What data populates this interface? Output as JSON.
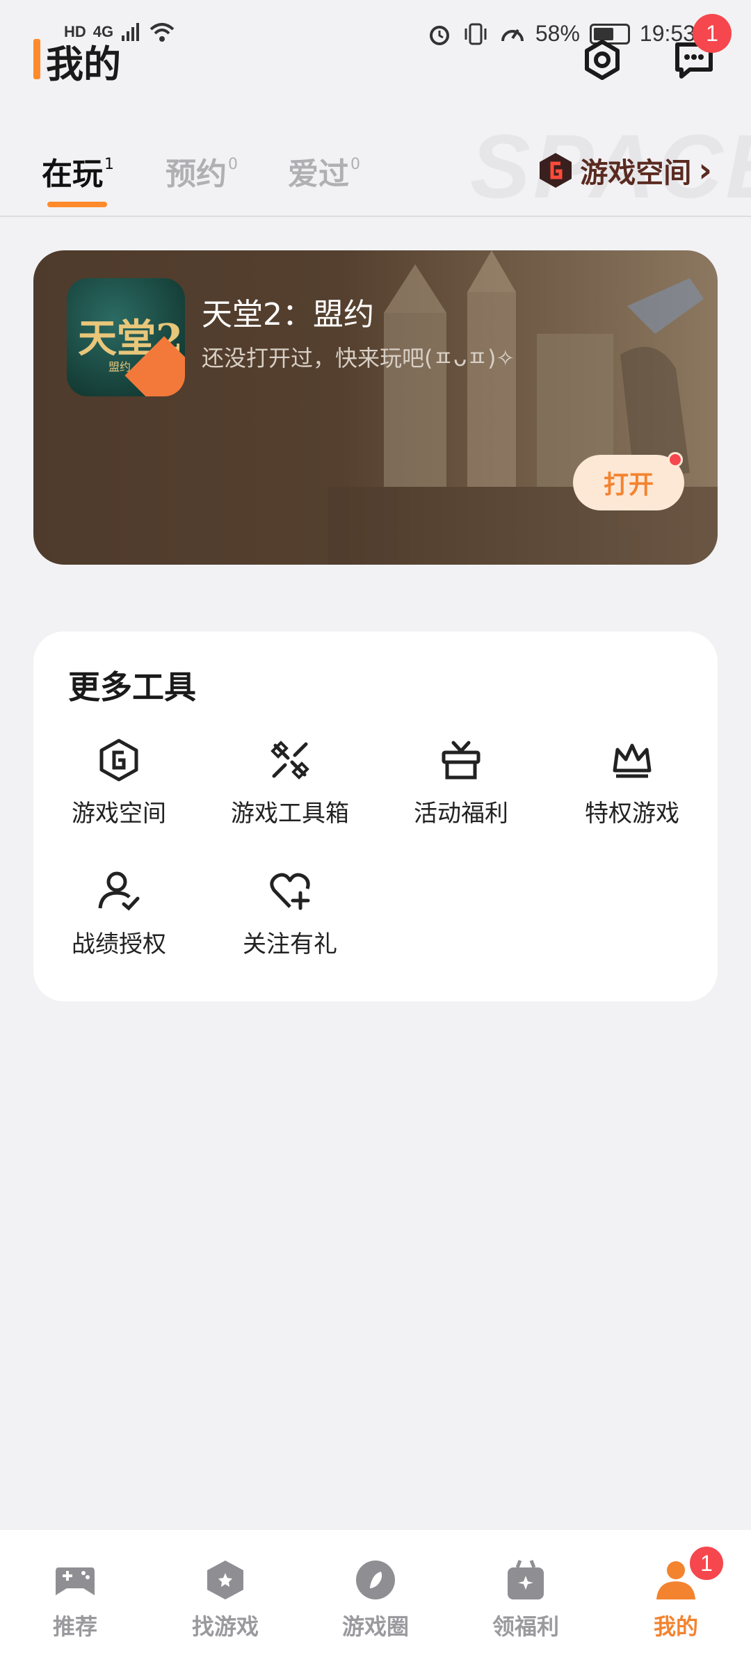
{
  "status_bar": {
    "left_items": [
      "HD",
      "4G"
    ],
    "battery": "58%",
    "time": "19:53"
  },
  "header": {
    "title": "我的",
    "message_badge": "1"
  },
  "tabs": [
    {
      "label": "在玩",
      "count": "1",
      "active": true
    },
    {
      "label": "预约",
      "count": "0",
      "active": false
    },
    {
      "label": "爱过",
      "count": "0",
      "active": false
    }
  ],
  "space_watermark": "SPACE",
  "space_link": {
    "label": "游戏空间",
    "chevron": "›"
  },
  "game_card": {
    "icon_title": "天堂2",
    "icon_sub": "盟约",
    "name": "天堂2：盟约",
    "subtitle": "还没打开过，快来玩吧(ㅍᴗㅍ)✧",
    "open_label": "打开"
  },
  "tools": {
    "title": "更多工具",
    "items": [
      {
        "label": "游戏空间",
        "icon": "game-space-icon"
      },
      {
        "label": "游戏工具箱",
        "icon": "toolbox-icon"
      },
      {
        "label": "活动福利",
        "icon": "gift-icon"
      },
      {
        "label": "特权游戏",
        "icon": "crown-icon"
      },
      {
        "label": "战绩授权",
        "icon": "user-check-icon"
      },
      {
        "label": "关注有礼",
        "icon": "heart-plus-icon"
      }
    ]
  },
  "bottom_nav": {
    "items": [
      {
        "label": "推荐",
        "icon": "gamepad-icon"
      },
      {
        "label": "找游戏",
        "icon": "hexagon-star-icon"
      },
      {
        "label": "游戏圈",
        "icon": "compass-icon"
      },
      {
        "label": "领福利",
        "icon": "gift-bag-icon"
      },
      {
        "label": "我的",
        "icon": "person-icon"
      }
    ],
    "active_index": 4,
    "badge": "1"
  },
  "colors": {
    "accent": "#ff8a2b",
    "badge": "#f5474d",
    "card_bg": "#4f3b2c"
  }
}
